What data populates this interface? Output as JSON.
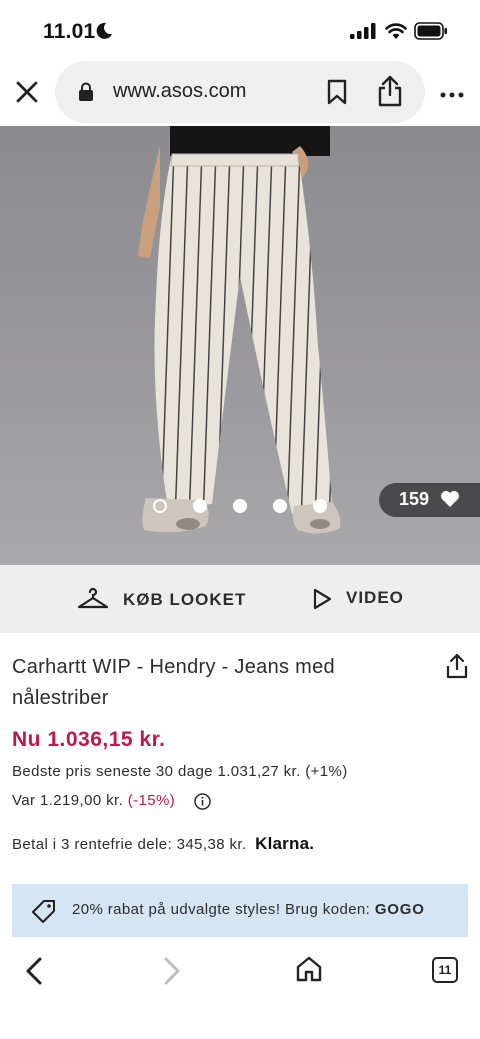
{
  "status_bar": {
    "time": "11.01"
  },
  "browser": {
    "url": "www.asos.com"
  },
  "gallery": {
    "likes": "159",
    "dot_count": 5,
    "active_dot": 0
  },
  "actions": {
    "buy_look_label": "KØB LOOKET",
    "video_label": "VIDEO"
  },
  "product": {
    "title": "Carhartt WIP - Hendry - Jeans med nålestriber",
    "price_now": "Nu 1.036,15 kr.",
    "best_price": "Bedste pris seneste 30 dage 1.031,27 kr. (+1%)",
    "was_price": "Var 1.219,00 kr.",
    "discount": "(-15%)",
    "klarna_text": "Betal i 3 rentefrie dele: 345,38 kr.",
    "klarna_brand": "Klarna."
  },
  "promo": {
    "text": "20% rabat på udvalgte styles! Brug koden:",
    "code": "GOGO"
  },
  "bottom_nav": {
    "tab_count": "11"
  },
  "colors": {
    "price_red": "#c1174b",
    "promo_bg": "#d5e5f4",
    "strip_bg": "#eeeeee",
    "url_pill_bg": "#efefef"
  }
}
